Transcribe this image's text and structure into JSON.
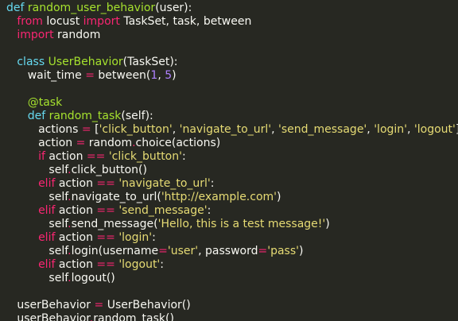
{
  "code": {
    "lines": [
      {
        "indent": 0,
        "tokens": [
          {
            "t": "kw",
            "v": "def "
          },
          {
            "t": "fn",
            "v": "random_user_behavior"
          },
          {
            "t": "txt",
            "v": "(user):"
          }
        ]
      },
      {
        "indent": 1,
        "tokens": [
          {
            "t": "op",
            "v": "from "
          },
          {
            "t": "txt",
            "v": "locust "
          },
          {
            "t": "op",
            "v": "import "
          },
          {
            "t": "txt",
            "v": "TaskSet, task, between"
          }
        ]
      },
      {
        "indent": 1,
        "tokens": [
          {
            "t": "op",
            "v": "import "
          },
          {
            "t": "txt",
            "v": "random"
          }
        ]
      },
      {
        "indent": 0,
        "tokens": []
      },
      {
        "indent": 1,
        "tokens": [
          {
            "t": "kw",
            "v": "class "
          },
          {
            "t": "cls",
            "v": "UserBehavior"
          },
          {
            "t": "txt",
            "v": "(TaskSet):"
          }
        ]
      },
      {
        "indent": 2,
        "tokens": [
          {
            "t": "txt",
            "v": "wait_time "
          },
          {
            "t": "op",
            "v": "="
          },
          {
            "t": "txt",
            "v": " between("
          },
          {
            "t": "num",
            "v": "1"
          },
          {
            "t": "txt",
            "v": ", "
          },
          {
            "t": "num",
            "v": "5"
          },
          {
            "t": "txt",
            "v": ")"
          }
        ]
      },
      {
        "indent": 0,
        "tokens": []
      },
      {
        "indent": 2,
        "tokens": [
          {
            "t": "dec",
            "v": "@task"
          }
        ]
      },
      {
        "indent": 2,
        "tokens": [
          {
            "t": "kw",
            "v": "def "
          },
          {
            "t": "fn",
            "v": "random_task"
          },
          {
            "t": "txt",
            "v": "(self):"
          }
        ]
      },
      {
        "indent": 3,
        "tokens": [
          {
            "t": "txt",
            "v": "actions "
          },
          {
            "t": "op",
            "v": "="
          },
          {
            "t": "txt",
            "v": " ["
          },
          {
            "t": "str",
            "v": "'click_button'"
          },
          {
            "t": "txt",
            "v": ", "
          },
          {
            "t": "str",
            "v": "'navigate_to_url'"
          },
          {
            "t": "txt",
            "v": ", "
          },
          {
            "t": "str",
            "v": "'send_message'"
          },
          {
            "t": "txt",
            "v": ", "
          },
          {
            "t": "str",
            "v": "'login'"
          },
          {
            "t": "txt",
            "v": ", "
          },
          {
            "t": "str",
            "v": "'logout'"
          },
          {
            "t": "txt",
            "v": "]"
          }
        ]
      },
      {
        "indent": 3,
        "tokens": [
          {
            "t": "txt",
            "v": "action "
          },
          {
            "t": "op",
            "v": "="
          },
          {
            "t": "txt",
            "v": " random"
          },
          {
            "t": "op",
            "v": "."
          },
          {
            "t": "txt",
            "v": "choice(actions)"
          }
        ]
      },
      {
        "indent": 3,
        "tokens": [
          {
            "t": "op",
            "v": "if "
          },
          {
            "t": "txt",
            "v": "action "
          },
          {
            "t": "op",
            "v": "=="
          },
          {
            "t": "txt",
            "v": " "
          },
          {
            "t": "str",
            "v": "'click_button'"
          },
          {
            "t": "txt",
            "v": ":"
          }
        ]
      },
      {
        "indent": 4,
        "tokens": [
          {
            "t": "txt",
            "v": "self"
          },
          {
            "t": "op",
            "v": "."
          },
          {
            "t": "txt",
            "v": "click_button()"
          }
        ]
      },
      {
        "indent": 3,
        "tokens": [
          {
            "t": "op",
            "v": "elif "
          },
          {
            "t": "txt",
            "v": "action "
          },
          {
            "t": "op",
            "v": "=="
          },
          {
            "t": "txt",
            "v": " "
          },
          {
            "t": "str",
            "v": "'navigate_to_url'"
          },
          {
            "t": "txt",
            "v": ":"
          }
        ]
      },
      {
        "indent": 4,
        "tokens": [
          {
            "t": "txt",
            "v": "self"
          },
          {
            "t": "op",
            "v": "."
          },
          {
            "t": "txt",
            "v": "navigate_to_url("
          },
          {
            "t": "str",
            "v": "'http://example.com'"
          },
          {
            "t": "txt",
            "v": ")"
          }
        ]
      },
      {
        "indent": 3,
        "tokens": [
          {
            "t": "op",
            "v": "elif "
          },
          {
            "t": "txt",
            "v": "action "
          },
          {
            "t": "op",
            "v": "=="
          },
          {
            "t": "txt",
            "v": " "
          },
          {
            "t": "str",
            "v": "'send_message'"
          },
          {
            "t": "txt",
            "v": ":"
          }
        ]
      },
      {
        "indent": 4,
        "tokens": [
          {
            "t": "txt",
            "v": "self"
          },
          {
            "t": "op",
            "v": "."
          },
          {
            "t": "txt",
            "v": "send_message("
          },
          {
            "t": "str",
            "v": "'Hello, this is a test message!'"
          },
          {
            "t": "txt",
            "v": ")"
          }
        ]
      },
      {
        "indent": 3,
        "tokens": [
          {
            "t": "op",
            "v": "elif "
          },
          {
            "t": "txt",
            "v": "action "
          },
          {
            "t": "op",
            "v": "=="
          },
          {
            "t": "txt",
            "v": " "
          },
          {
            "t": "str",
            "v": "'login'"
          },
          {
            "t": "txt",
            "v": ":"
          }
        ]
      },
      {
        "indent": 4,
        "tokens": [
          {
            "t": "txt",
            "v": "self"
          },
          {
            "t": "op",
            "v": "."
          },
          {
            "t": "txt",
            "v": "login(username"
          },
          {
            "t": "op",
            "v": "="
          },
          {
            "t": "str",
            "v": "'user'"
          },
          {
            "t": "txt",
            "v": ", password"
          },
          {
            "t": "op",
            "v": "="
          },
          {
            "t": "str",
            "v": "'pass'"
          },
          {
            "t": "txt",
            "v": ")"
          }
        ]
      },
      {
        "indent": 3,
        "tokens": [
          {
            "t": "op",
            "v": "elif "
          },
          {
            "t": "txt",
            "v": "action "
          },
          {
            "t": "op",
            "v": "=="
          },
          {
            "t": "txt",
            "v": " "
          },
          {
            "t": "str",
            "v": "'logout'"
          },
          {
            "t": "txt",
            "v": ":"
          }
        ]
      },
      {
        "indent": 4,
        "tokens": [
          {
            "t": "txt",
            "v": "self"
          },
          {
            "t": "op",
            "v": "."
          },
          {
            "t": "txt",
            "v": "logout()"
          }
        ]
      },
      {
        "indent": 0,
        "tokens": []
      },
      {
        "indent": 1,
        "tokens": [
          {
            "t": "txt",
            "v": "userBehavior "
          },
          {
            "t": "op",
            "v": "="
          },
          {
            "t": "txt",
            "v": " UserBehavior()"
          }
        ]
      },
      {
        "indent": 1,
        "tokens": [
          {
            "t": "txt",
            "v": "userBehavior"
          },
          {
            "t": "op",
            "v": "."
          },
          {
            "t": "txt",
            "v": "random_task()"
          }
        ]
      }
    ]
  },
  "colors": {
    "background": "#272822",
    "text": "#f8f8f2",
    "keyword": "#66d9ef",
    "operator": "#f92672",
    "function": "#a6e22e",
    "string": "#e6db74",
    "number": "#ae81ff"
  }
}
